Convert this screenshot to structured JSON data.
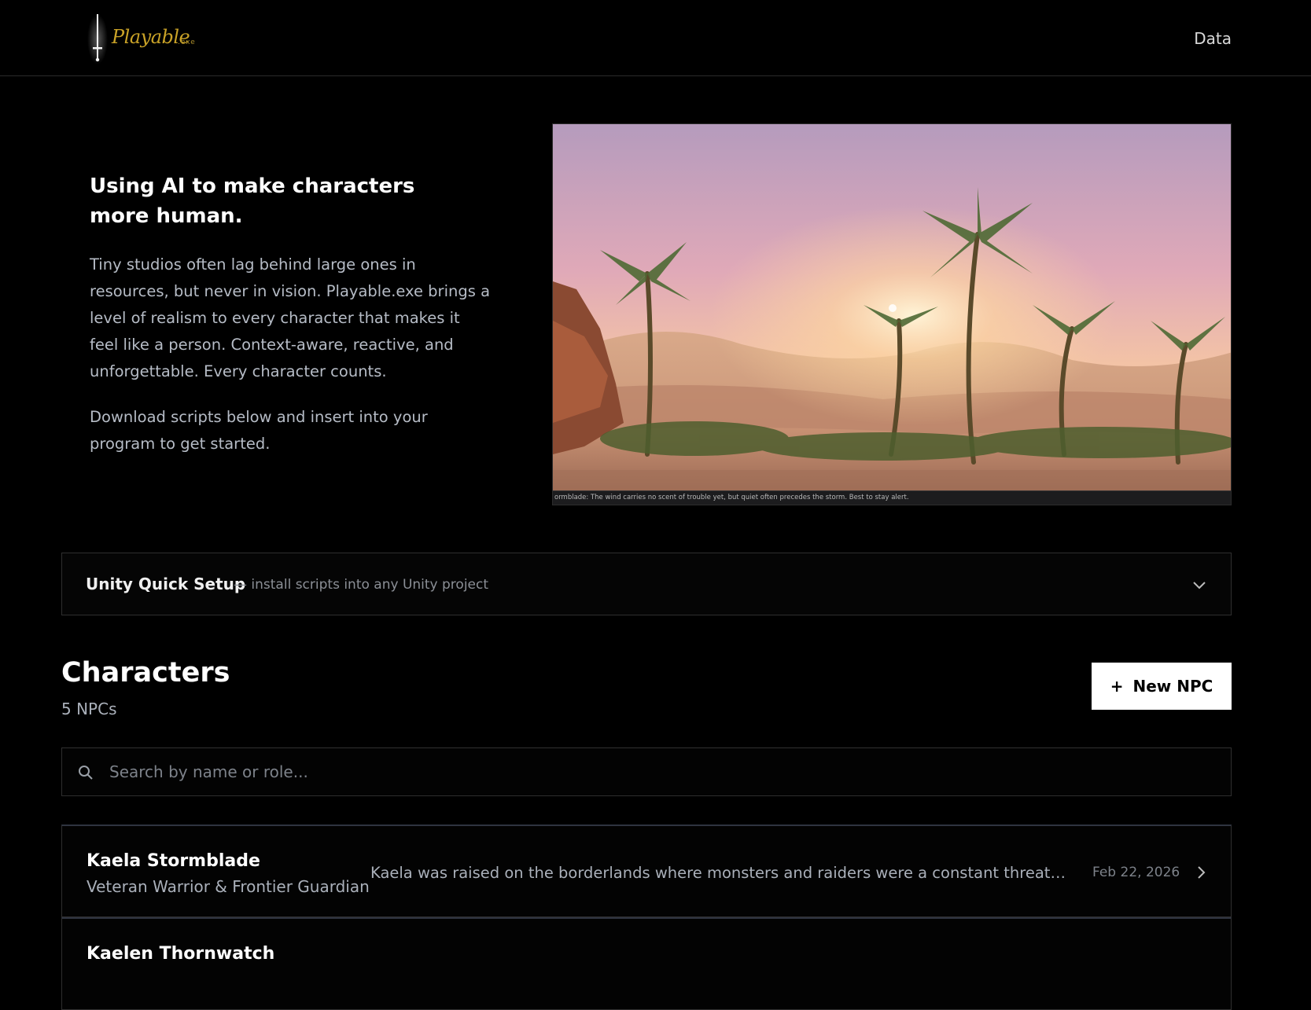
{
  "header": {
    "logo_text": "Playable",
    "logo_ext": ".exe",
    "nav_data": "Data"
  },
  "hero": {
    "title": "Using AI to make characters more human.",
    "paragraph1": "Tiny studios often lag behind large ones in resources, but never in vision. Playable.exe brings a level of realism to every character that makes it feel like a person. Context-aware, reactive, and unforgettable. Every character counts.",
    "paragraph2": "Download scripts below and insert into your program to get started.",
    "media_subtitle": "ormblade: The wind carries no scent of trouble yet, but quiet often precedes the storm. Best to stay alert."
  },
  "setup": {
    "title": "Unity Quick Setup",
    "subtitle": "— install scripts into any Unity project",
    "icon": "chevron-down-icon"
  },
  "characters": {
    "title": "Characters",
    "count": "5 NPCs",
    "new_button": "New NPC",
    "new_button_icon": "+",
    "search_placeholder": "Search by name or role...",
    "items": [
      {
        "name": "Kaela Stormblade",
        "role": "Veteran Warrior & Frontier Guardian",
        "description": "Kaela was raised on the borderlands where monsters and raiders were a constant threat. Traine...",
        "date": "Feb 22, 2026"
      },
      {
        "name": "Kaelen Thornwatch",
        "role": "",
        "description": "",
        "date": ""
      }
    ]
  },
  "colors": {
    "background": "#000000",
    "logo_gold": "#c9a227",
    "button_bg": "#ffffff"
  }
}
